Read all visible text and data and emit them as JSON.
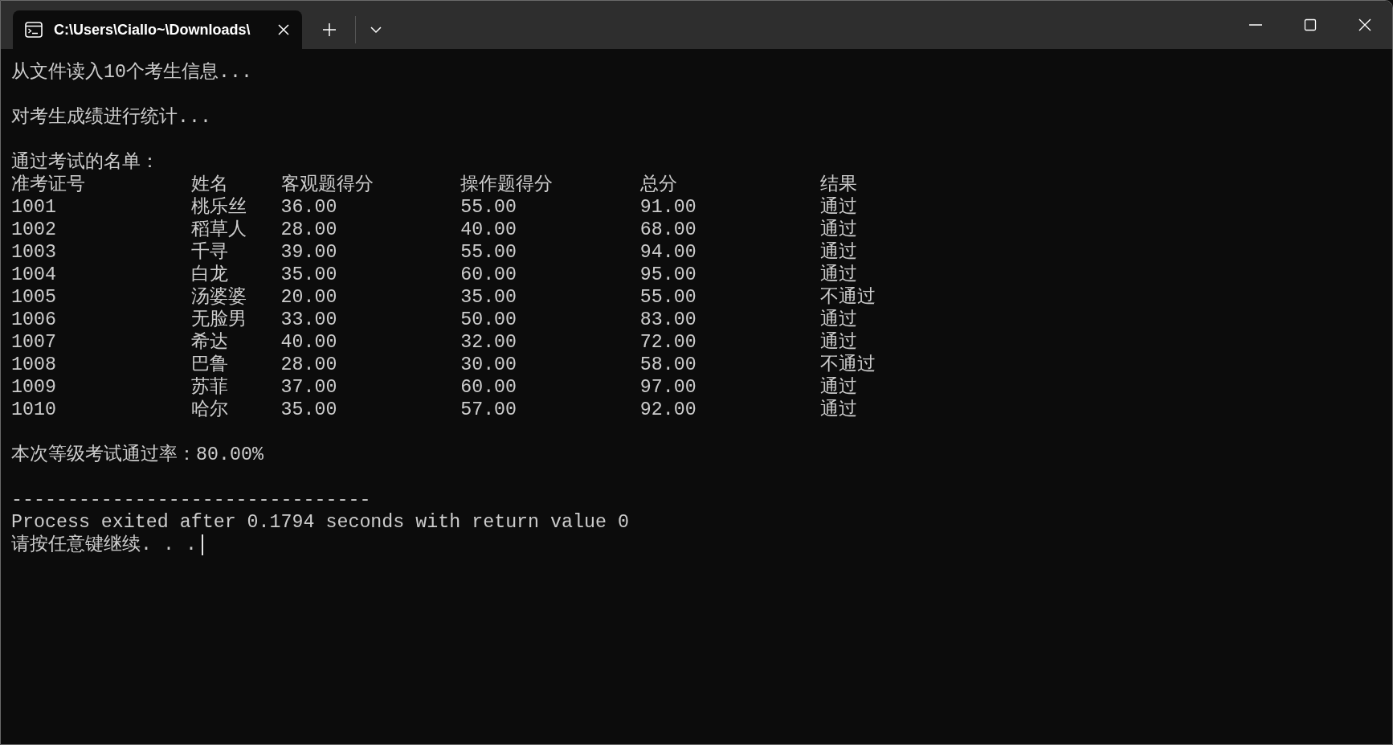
{
  "window": {
    "tab_title": "C:\\Users\\Ciallo~\\Downloads\\"
  },
  "console": [
    {
      "kind": "line",
      "text": "从文件读入10个考生信息..."
    },
    {
      "kind": "blank"
    },
    {
      "kind": "line",
      "text": "对考生成绩进行统计..."
    },
    {
      "kind": "blank"
    },
    {
      "kind": "line",
      "text": "通过考试的名单："
    },
    {
      "kind": "table",
      "columns": [
        "准考证号",
        "姓名",
        "客观题得分",
        "操作题得分",
        "总分",
        "结果"
      ],
      "rows": [
        [
          "1001",
          "桃乐丝",
          "36.00",
          "55.00",
          "91.00",
          "通过"
        ],
        [
          "1002",
          "稻草人",
          "28.00",
          "40.00",
          "68.00",
          "通过"
        ],
        [
          "1003",
          "千寻",
          "39.00",
          "55.00",
          "94.00",
          "通过"
        ],
        [
          "1004",
          "白龙",
          "35.00",
          "60.00",
          "95.00",
          "通过"
        ],
        [
          "1005",
          "汤婆婆",
          "20.00",
          "35.00",
          "55.00",
          "不通过"
        ],
        [
          "1006",
          "无脸男",
          "33.00",
          "50.00",
          "83.00",
          "通过"
        ],
        [
          "1007",
          "希达",
          "40.00",
          "32.00",
          "72.00",
          "通过"
        ],
        [
          "1008",
          "巴鲁",
          "28.00",
          "30.00",
          "58.00",
          "不通过"
        ],
        [
          "1009",
          "苏菲",
          "37.00",
          "60.00",
          "97.00",
          "通过"
        ],
        [
          "1010",
          "哈尔",
          "35.00",
          "57.00",
          "92.00",
          "通过"
        ]
      ]
    },
    {
      "kind": "blank"
    },
    {
      "kind": "line",
      "text": "本次等级考试通过率：80.00%"
    },
    {
      "kind": "blank"
    },
    {
      "kind": "line",
      "text": "--------------------------------"
    },
    {
      "kind": "line",
      "text": "Process exited after 0.1794 seconds with return value 0"
    },
    {
      "kind": "prompt",
      "text": "请按任意键继续. . ."
    }
  ]
}
